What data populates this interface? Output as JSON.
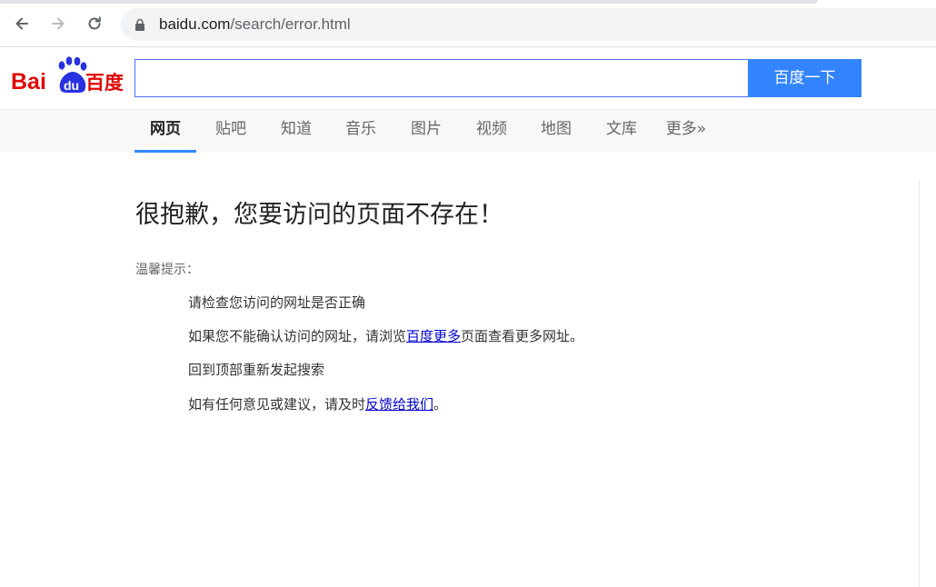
{
  "browser": {
    "url_domain": "baidu.com",
    "url_path": "/search/error.html",
    "back_icon": "arrow-left-icon",
    "forward_icon": "arrow-right-icon",
    "reload_icon": "reload-icon",
    "lock_icon": "lock-icon"
  },
  "header": {
    "logo_text_left": "Bai",
    "logo_text_du": "du",
    "logo_text_right": "百度",
    "search_value": "",
    "search_button_label": "百度一下"
  },
  "tabs": [
    {
      "label": "网页",
      "active": true
    },
    {
      "label": "贴吧"
    },
    {
      "label": "知道"
    },
    {
      "label": "音乐"
    },
    {
      "label": "图片"
    },
    {
      "label": "视频"
    },
    {
      "label": "地图"
    },
    {
      "label": "文库"
    },
    {
      "label": "更多»"
    }
  ],
  "content": {
    "title": "很抱歉，您要访问的页面不存在！",
    "tip_heading": "温馨提示：",
    "tip1": "请检查您访问的网址是否正确",
    "tip2_before": "如果您不能确认访问的网址，请浏览",
    "tip2_link": "百度更多",
    "tip2_after": "页面查看更多网址。",
    "tip3": "回到顶部重新发起搜索",
    "tip4_before": "如有任何意见或建议，请及时",
    "tip4_link": "反馈给我们",
    "tip4_after": "。"
  },
  "colors": {
    "brand_red": "#e10601",
    "brand_blue": "#2932e1",
    "button_blue": "#3385ff",
    "link": "#0000cc"
  }
}
